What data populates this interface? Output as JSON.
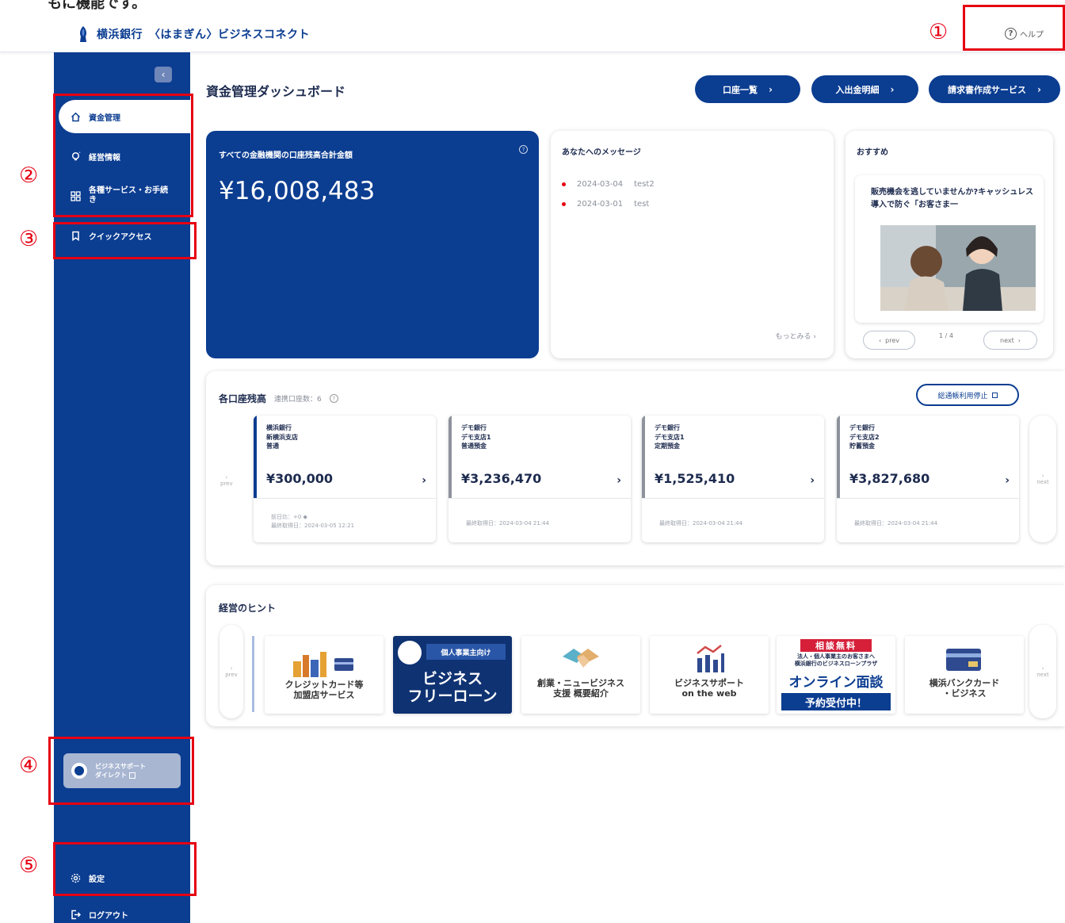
{
  "header": {
    "bank_name": "横浜銀行",
    "service_name": "〈はまぎん〉ビジネスコネクト",
    "help_label": "ヘルプ"
  },
  "sidebar": {
    "collapse_label": "‹",
    "items": [
      {
        "label": "資金管理",
        "icon": "home-icon"
      },
      {
        "label": "経営情報",
        "icon": "bulb-icon"
      },
      {
        "label": "各種サービス・お手続き",
        "icon": "grid-icon"
      },
      {
        "label": "クイックアクセス",
        "icon": "bookmark-icon"
      }
    ],
    "bsd_line1": "ビジネスサポート",
    "bsd_line2": "ダイレクト",
    "settings_label": "設定",
    "logout_label": "ログアウト"
  },
  "annotations": [
    "①",
    "②",
    "③",
    "④",
    "⑤"
  ],
  "main": {
    "title": "資金管理ダッシュボード",
    "buttons": [
      {
        "label": "口座一覧"
      },
      {
        "label": "入出金明細"
      },
      {
        "label": "請求書作成サービス"
      }
    ]
  },
  "total": {
    "label": "すべての金融機関の口座残高合計金額",
    "amount": "¥16,008,483"
  },
  "messages": {
    "title": "あなたへのメッセージ",
    "items": [
      {
        "date": "2024-03-04",
        "text": "test2"
      },
      {
        "date": "2024-03-01",
        "text": "test"
      }
    ],
    "more": "もっとみる ›"
  },
  "recommend": {
    "title": "おすすめ",
    "text": "販売機会を逃していませんか?キャッシュレス導入で防ぐ「お客さま一",
    "prev": "prev",
    "next": "next",
    "page": "1 / 4"
  },
  "accounts": {
    "title": "各口座残高",
    "linked": "連携口座数：6",
    "stop_label": "総通帳利用停止",
    "prev": "prev",
    "next": "next",
    "cards": [
      {
        "bank": "横浜銀行",
        "branch": "新横浜支店",
        "type": "普通",
        "amount": "¥300,000",
        "foot1": "前日比：+0 ◆",
        "foot2": "最終取得日：2024-03-05 12:21"
      },
      {
        "bank": "デモ銀行",
        "branch": "デモ支店1",
        "type": "普通預金",
        "amount": "¥3,236,470",
        "foot1": "",
        "foot2": "最終取得日：2024-03-04 21:44"
      },
      {
        "bank": "デモ銀行",
        "branch": "デモ支店1",
        "type": "定期預金",
        "amount": "¥1,525,410",
        "foot1": "",
        "foot2": "最終取得日：2024-03-04 21:44"
      },
      {
        "bank": "デモ銀行",
        "branch": "デモ支店2",
        "type": "貯蓄預金",
        "amount": "¥3,827,680",
        "foot1": "",
        "foot2": "最終取得日：2024-03-04 21:44"
      }
    ]
  },
  "hints": {
    "title": "経営のヒント",
    "prev": "prev",
    "next": "next",
    "tiles": [
      {
        "line1": "クレジットカード等",
        "line2": "加盟店サービス"
      },
      {
        "badge": "個人事業主向け",
        "line1": "ビジネス",
        "line2": "フリーローン"
      },
      {
        "line1": "創業・ニュービジネス",
        "line2": "支援 概要紹介"
      },
      {
        "line1": "ビジネスサポート",
        "line2": "on the web"
      },
      {
        "top": "相談無料",
        "sub1": "法人・個人事業主のお客さまへ",
        "sub2": "横浜銀行のビジネスローンプラザ",
        "line1": "オンライン面談",
        "line2": "予約受付中！"
      },
      {
        "line1": "横浜バンクカード",
        "line2": "・ビジネス"
      }
    ]
  }
}
